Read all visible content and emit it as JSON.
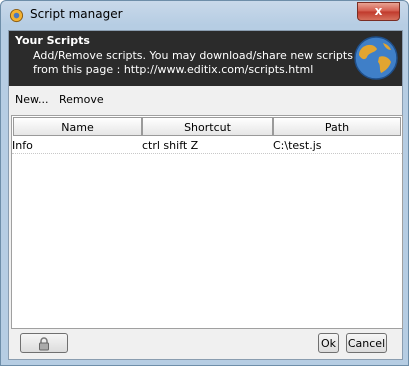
{
  "window": {
    "title": "Script manager",
    "close_label": "x"
  },
  "header": {
    "title": "Your Scripts",
    "description": "Add/Remove scripts. You may download/share new scripts from this page : http://www.editix.com/scripts.html"
  },
  "toolbar": {
    "new_label": "New...",
    "remove_label": "Remove"
  },
  "table": {
    "columns": [
      "Name",
      "Shortcut",
      "Path"
    ],
    "rows": [
      {
        "name": "Info",
        "shortcut": "ctrl shift Z",
        "path": "C:\\test.js"
      }
    ]
  },
  "footer": {
    "ok_label": "Ok",
    "cancel_label": "Cancel"
  },
  "icons": {
    "app": "gear-icon",
    "header": "globe-icon",
    "footer": "lock-icon"
  },
  "colors": {
    "header_bg": "#2b2b2b",
    "close_button": "#c0392b"
  }
}
